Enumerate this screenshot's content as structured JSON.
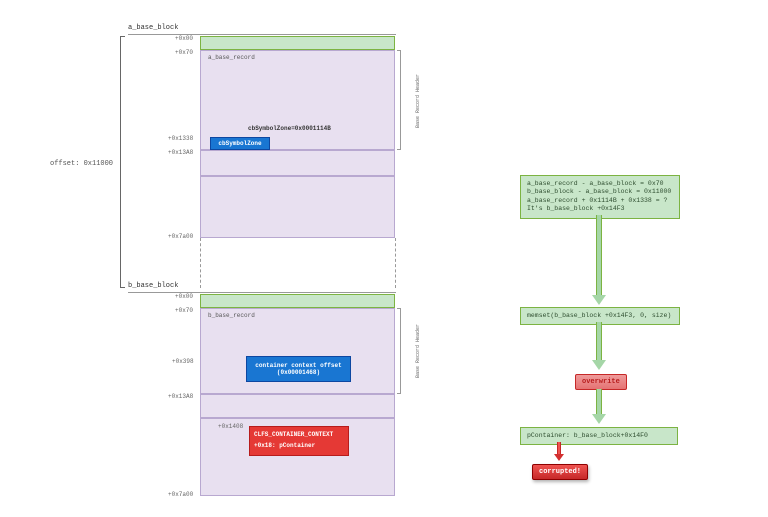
{
  "left": {
    "a_block": {
      "title": "a_base_block",
      "record_title": "a_base_record",
      "offsets": {
        "o0": "+0x00",
        "o70": "+0x70",
        "o1338": "+0x1338",
        "o13a8": "+0x13A8",
        "o7a00": "+0x7a00"
      },
      "cbSymbolZone_label": "cbSymbolZone=0x0001114B",
      "blue_box": "cbSymbolZone"
    },
    "b_block": {
      "title": "b_base_block",
      "record_title": "b_base_record",
      "offsets": {
        "o0": "+0x00",
        "o70": "+0x70",
        "o398": "+0x398",
        "o13a8": "+0x13A8",
        "o1408": "+0x1408",
        "o7a00": "+0x7a00"
      },
      "blue_box_line1": "container context offset",
      "blue_box_line2": "(0x00001468)",
      "red_box_line1": "CLFS_CONTAINER_CONTEXT",
      "red_box_line2": "+0x18: pContainer"
    },
    "side": {
      "header_a": "Base Record Header",
      "header_b": "Base Record Header",
      "offset_label": "offset: 0x11000"
    }
  },
  "right": {
    "calc": {
      "l1": "a_base_record - a_base_block = 0x70",
      "l2": "b_base_block - a_base_block = 0x11000",
      "l3": "a_base_record + 0x1114B + 0x1338 = ?",
      "l4": "It's b_base_block +0x14F3"
    },
    "memset_box": "memset(b_base_block +0x14F3, 0, size)",
    "overwrite": "overwrite",
    "pcontainer_box": "pContainer: b_base_block+0x14F0",
    "corrupted": "corrupted!"
  }
}
